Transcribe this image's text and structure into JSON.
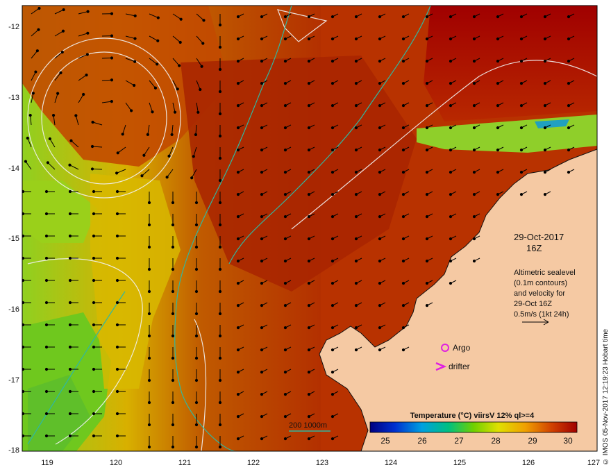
{
  "map": {
    "lon_ticks": [
      "119",
      "120",
      "121",
      "122",
      "123",
      "124",
      "125",
      "126",
      "127"
    ],
    "lat_ticks": [
      "-12",
      "-13",
      "-14",
      "-15",
      "-16",
      "-17",
      "-18"
    ],
    "date_label": "29-Oct-2017",
    "time_label": "16Z",
    "altimetry_lines": [
      "Altimetric sealevel",
      "(0.1m contours)",
      "and velocity for",
      "29-Oct 16Z",
      "0.5m/s (1kt 24h)"
    ],
    "argo_label": "Argo",
    "drifter_label": "drifter",
    "isobath_label": "200  1000m",
    "colorbar_title": "Temperature (°C) viirsV 12% ql>=4",
    "colorbar_ticks": [
      "25",
      "26",
      "27",
      "28",
      "29",
      "30"
    ],
    "credit": "© IMOS 05-Nov-2017 12:19:23 Hobart time",
    "colors": {
      "land": "#f5c9a3",
      "sst_warm": "#b33000",
      "sst_hot": "#a00000",
      "sst_mid": "#d9a000",
      "sst_cool": "#7ccd20",
      "isobath": "#2fb8a0",
      "argo": "#e020e0"
    }
  }
}
